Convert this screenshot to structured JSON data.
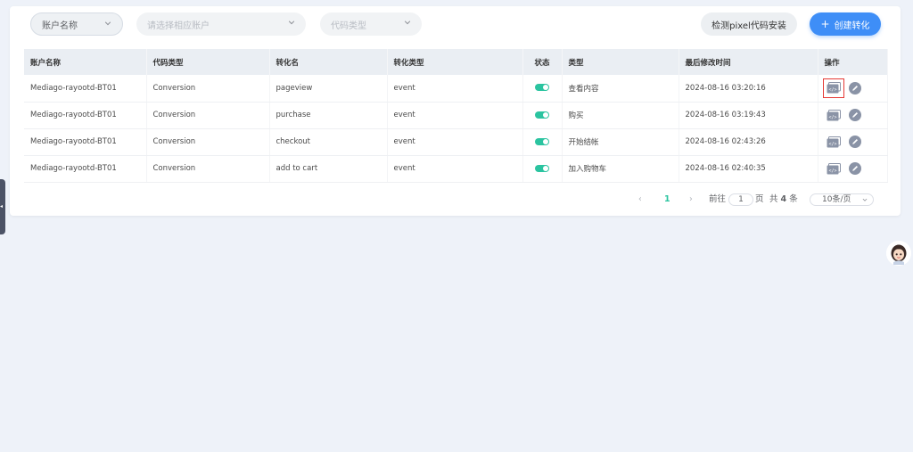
{
  "filters": {
    "account": "账户名称",
    "account_select_placeholder": "请选择相应账户",
    "code_type": "代码类型"
  },
  "buttons": {
    "check_pixel": "检测pixel代码安装",
    "create_icon": "+",
    "create": "创建转化"
  },
  "table": {
    "headers": [
      "账户名称",
      "代码类型",
      "转化名",
      "转化类型",
      "状态",
      "类型",
      "最后修改时间",
      "操作"
    ],
    "rows": [
      {
        "account": "Mediago-rayootd-BT01",
        "code_type": "Conversion",
        "name": "pageview",
        "conv_type": "event",
        "status": "on",
        "category": "查看内容",
        "modified": "2024-08-16 03:20:16"
      },
      {
        "account": "Mediago-rayootd-BT01",
        "code_type": "Conversion",
        "name": "purchase",
        "conv_type": "event",
        "status": "on",
        "category": "购买",
        "modified": "2024-08-16 03:19:43"
      },
      {
        "account": "Mediago-rayootd-BT01",
        "code_type": "Conversion",
        "name": "checkout",
        "conv_type": "event",
        "status": "on",
        "category": "开始结帐",
        "modified": "2024-08-16 02:43:26"
      },
      {
        "account": "Mediago-rayootd-BT01",
        "code_type": "Conversion",
        "name": "add to cart",
        "conv_type": "event",
        "status": "on",
        "category": "加入购物车",
        "modified": "2024-08-16 02:40:35"
      }
    ]
  },
  "pagination": {
    "prev": "‹",
    "current": "1",
    "next": "›",
    "goto_label": "前往",
    "goto_value": "1",
    "page_label": "页",
    "total_prefix": "共",
    "total_count": "4",
    "total_suffix": "条",
    "page_size": "10条/页"
  },
  "side_tab": {
    "arrow": "◂"
  },
  "colors": {
    "accent": "#3e8ef7",
    "toggle_on": "#2bc4a0",
    "highlight": "#e53935",
    "background": "#eef2f9"
  },
  "icons": {
    "filter_chevron": "chevron-down-icon",
    "row_code": "code-view-icon",
    "row_edit": "pencil-edit-icon",
    "avatar": "assistant-avatar-icon"
  }
}
